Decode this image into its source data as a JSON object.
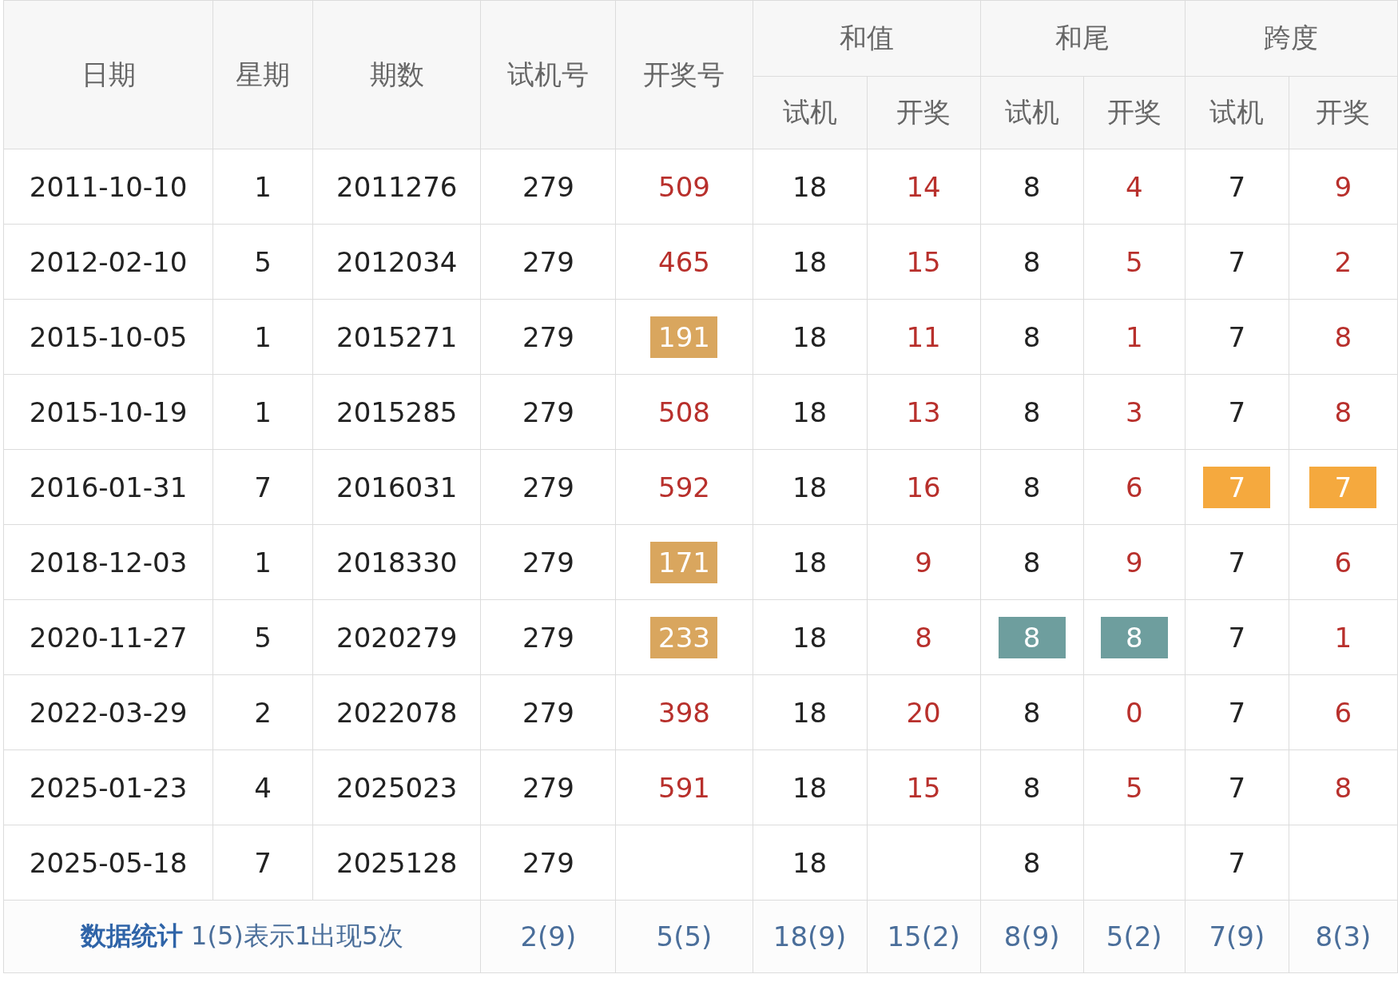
{
  "table": {
    "header": [
      {
        "label": "日期"
      },
      {
        "label": "星期"
      },
      {
        "label": "期数"
      },
      {
        "label": "试机号"
      },
      {
        "label": "开奖号"
      }
    ],
    "groups": [
      {
        "label": "和值",
        "sub": [
          "试机",
          "开奖"
        ]
      },
      {
        "label": "和尾",
        "sub": [
          "试机",
          "开奖"
        ]
      },
      {
        "label": "跨度",
        "sub": [
          "试机",
          "开奖"
        ]
      }
    ],
    "rows": [
      {
        "cells": [
          {
            "kind": "plain",
            "text": "2011-10-10"
          },
          {
            "kind": "plain",
            "text": "1"
          },
          {
            "kind": "plain",
            "text": "2011276"
          },
          {
            "kind": "plain",
            "text": "279"
          },
          {
            "kind": "draw",
            "text": "509"
          },
          {
            "kind": "plain",
            "text": "18"
          },
          {
            "kind": "draw",
            "text": "14"
          },
          {
            "kind": "plain",
            "text": "8"
          },
          {
            "kind": "draw",
            "text": "4"
          },
          {
            "kind": "plain",
            "text": "7"
          },
          {
            "kind": "draw",
            "text": "9"
          }
        ]
      },
      {
        "cells": [
          {
            "kind": "plain",
            "text": "2012-02-10"
          },
          {
            "kind": "plain",
            "text": "5"
          },
          {
            "kind": "plain",
            "text": "2012034"
          },
          {
            "kind": "plain",
            "text": "279"
          },
          {
            "kind": "draw",
            "text": "465"
          },
          {
            "kind": "plain",
            "text": "18"
          },
          {
            "kind": "draw",
            "text": "15"
          },
          {
            "kind": "plain",
            "text": "8"
          },
          {
            "kind": "draw",
            "text": "5"
          },
          {
            "kind": "plain",
            "text": "7"
          },
          {
            "kind": "draw",
            "text": "2"
          }
        ]
      },
      {
        "cells": [
          {
            "kind": "plain",
            "text": "2015-10-05"
          },
          {
            "kind": "plain",
            "text": "1"
          },
          {
            "kind": "plain",
            "text": "2015271"
          },
          {
            "kind": "plain",
            "text": "279"
          },
          {
            "kind": "draw",
            "text": "191",
            "color": "#d9a65e"
          },
          {
            "kind": "plain",
            "text": "18"
          },
          {
            "kind": "draw",
            "text": "11"
          },
          {
            "kind": "plain",
            "text": "8"
          },
          {
            "kind": "draw",
            "text": "1"
          },
          {
            "kind": "plain",
            "text": "7"
          },
          {
            "kind": "draw",
            "text": "8"
          }
        ]
      },
      {
        "cells": [
          {
            "kind": "plain",
            "text": "2015-10-19"
          },
          {
            "kind": "plain",
            "text": "1"
          },
          {
            "kind": "plain",
            "text": "2015285"
          },
          {
            "kind": "plain",
            "text": "279"
          },
          {
            "kind": "draw",
            "text": "508"
          },
          {
            "kind": "plain",
            "text": "18"
          },
          {
            "kind": "draw",
            "text": "13"
          },
          {
            "kind": "plain",
            "text": "8"
          },
          {
            "kind": "draw",
            "text": "3"
          },
          {
            "kind": "plain",
            "text": "7"
          },
          {
            "kind": "draw",
            "text": "8"
          }
        ]
      },
      {
        "cells": [
          {
            "kind": "plain",
            "text": "2016-01-31"
          },
          {
            "kind": "plain",
            "text": "7"
          },
          {
            "kind": "plain",
            "text": "2016031"
          },
          {
            "kind": "plain",
            "text": "279"
          },
          {
            "kind": "draw",
            "text": "592"
          },
          {
            "kind": "plain",
            "text": "18"
          },
          {
            "kind": "draw",
            "text": "16"
          },
          {
            "kind": "plain",
            "text": "8"
          },
          {
            "kind": "draw",
            "text": "6"
          },
          {
            "kind": "plain",
            "text": "7",
            "color": "#f5a93e"
          },
          {
            "kind": "draw",
            "text": "7",
            "color": "#f5a93e"
          }
        ]
      },
      {
        "cells": [
          {
            "kind": "plain",
            "text": "2018-12-03"
          },
          {
            "kind": "plain",
            "text": "1"
          },
          {
            "kind": "plain",
            "text": "2018330"
          },
          {
            "kind": "plain",
            "text": "279"
          },
          {
            "kind": "draw",
            "text": "171",
            "color": "#d9a65e"
          },
          {
            "kind": "plain",
            "text": "18"
          },
          {
            "kind": "draw",
            "text": "9"
          },
          {
            "kind": "plain",
            "text": "8"
          },
          {
            "kind": "draw",
            "text": "9"
          },
          {
            "kind": "plain",
            "text": "7"
          },
          {
            "kind": "draw",
            "text": "6"
          }
        ]
      },
      {
        "cells": [
          {
            "kind": "plain",
            "text": "2020-11-27"
          },
          {
            "kind": "plain",
            "text": "5"
          },
          {
            "kind": "plain",
            "text": "2020279"
          },
          {
            "kind": "plain",
            "text": "279"
          },
          {
            "kind": "draw",
            "text": "233",
            "color": "#d9a65e"
          },
          {
            "kind": "plain",
            "text": "18"
          },
          {
            "kind": "draw",
            "text": "8"
          },
          {
            "kind": "plain",
            "text": "8",
            "color": "#6e9e9e"
          },
          {
            "kind": "draw",
            "text": "8",
            "color": "#6e9e9e"
          },
          {
            "kind": "plain",
            "text": "7"
          },
          {
            "kind": "draw",
            "text": "1"
          }
        ]
      },
      {
        "cells": [
          {
            "kind": "plain",
            "text": "2022-03-29"
          },
          {
            "kind": "plain",
            "text": "2"
          },
          {
            "kind": "plain",
            "text": "2022078"
          },
          {
            "kind": "plain",
            "text": "279"
          },
          {
            "kind": "draw",
            "text": "398"
          },
          {
            "kind": "plain",
            "text": "18"
          },
          {
            "kind": "draw",
            "text": "20"
          },
          {
            "kind": "plain",
            "text": "8"
          },
          {
            "kind": "draw",
            "text": "0"
          },
          {
            "kind": "plain",
            "text": "7"
          },
          {
            "kind": "draw",
            "text": "6"
          }
        ]
      },
      {
        "cells": [
          {
            "kind": "plain",
            "text": "2025-01-23"
          },
          {
            "kind": "plain",
            "text": "4"
          },
          {
            "kind": "plain",
            "text": "2025023"
          },
          {
            "kind": "plain",
            "text": "279"
          },
          {
            "kind": "draw",
            "text": "591"
          },
          {
            "kind": "plain",
            "text": "18"
          },
          {
            "kind": "draw",
            "text": "15"
          },
          {
            "kind": "plain",
            "text": "8"
          },
          {
            "kind": "draw",
            "text": "5"
          },
          {
            "kind": "plain",
            "text": "7"
          },
          {
            "kind": "draw",
            "text": "8"
          }
        ]
      },
      {
        "cells": [
          {
            "kind": "plain",
            "text": "2025-05-18"
          },
          {
            "kind": "plain",
            "text": "7"
          },
          {
            "kind": "plain",
            "text": "2025128"
          },
          {
            "kind": "plain",
            "text": "279"
          },
          {
            "kind": "blank"
          },
          {
            "kind": "plain",
            "text": "18"
          },
          {
            "kind": "blank"
          },
          {
            "kind": "plain",
            "text": "8"
          },
          {
            "kind": "blank"
          },
          {
            "kind": "plain",
            "text": "7"
          },
          {
            "kind": "blank"
          }
        ]
      }
    ],
    "footer": {
      "note": "**数据统计** 1(5)表示1出现5次",
      "stats": [
        "2(9)",
        "5(5)",
        "18(9)",
        "15(2)",
        "8(9)",
        "5(2)",
        "7(9)",
        "8(3)"
      ]
    }
  }
}
